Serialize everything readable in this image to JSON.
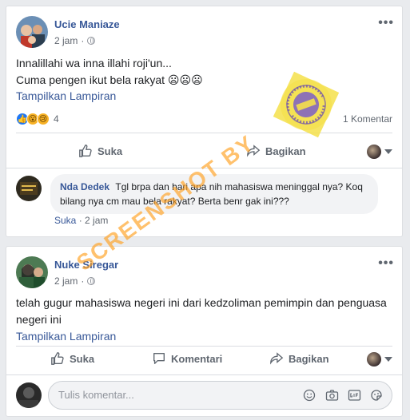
{
  "posts": [
    {
      "author": "Ucie Maniaze",
      "time": "2 jam",
      "text_line1": "Innalillahi wa inna illahi roji'un...",
      "text_line2": "Cuma pengen ikut bela rakyat 😦😦😦",
      "attachment_link": "Tampilkan Lampiran",
      "reaction_count": "4",
      "comment_count": "1 Komentar",
      "actions": {
        "like": "Suka",
        "share": "Bagikan"
      },
      "comments": [
        {
          "author": "Nda Dedek",
          "text": "Tgl brpa dan hari apa nih mahasiswa meninggal nya? Koq bilang nya cm mau bela rakyat? Berta benr gak ini???",
          "like": "Suka",
          "time": "2 jam"
        }
      ]
    },
    {
      "author": "Nuke Siregar",
      "time": "2 jam",
      "text_line1": "telah gugur mahasiswa negeri ini dari kedzoliman pemimpin dan penguasa",
      "text_line2": "negeri ini",
      "attachment_link": "Tampilkan Lampiran",
      "actions": {
        "like": "Suka",
        "comment": "Komentari",
        "share": "Bagikan"
      },
      "comment_input": {
        "placeholder": "Tulis komentar..."
      }
    }
  ],
  "more_glyph": "•••",
  "watermark_text": "SCREENSHOT BY",
  "seal": {
    "center": "TURN BACK HOAX",
    "ring": "MASYARAKAT ANTI FITNAH INDONESIA · MAFINDO"
  },
  "colors": {
    "link": "#385898",
    "muted": "#606770",
    "like_blue": "#2078f4",
    "watermark": "#ffa01e"
  },
  "icons": [
    "thumbs-up-icon",
    "share-arrow-icon",
    "comment-bubble-icon",
    "globe-icon",
    "emoji-icon",
    "camera-icon",
    "gif-icon",
    "sticker-icon",
    "more-dots-icon",
    "caret-down-icon"
  ]
}
